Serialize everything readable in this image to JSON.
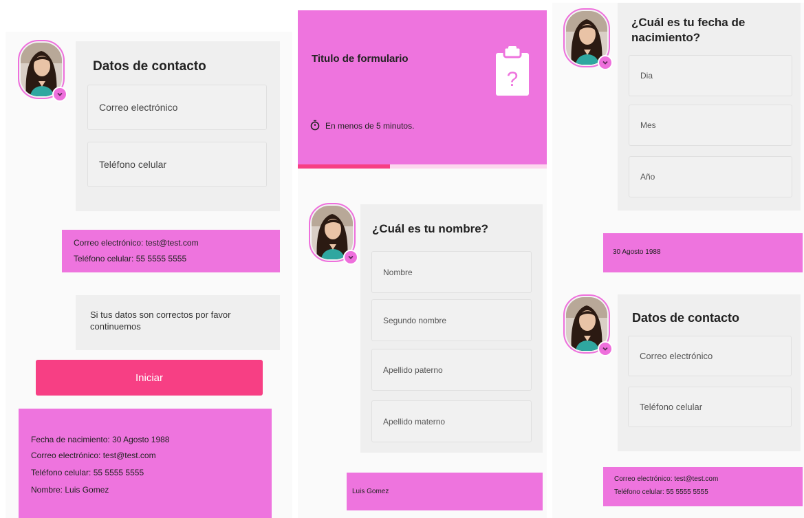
{
  "screen1": {
    "card_title": "Datos de contacto",
    "field_email": "Correo electrónico",
    "field_phone": "Teléfono celular",
    "answer_lines": [
      "Correo electrónico: test@test.com",
      "Teléfono celular: 55 5555 5555"
    ],
    "confirm_text": "Si tus datos son correctos por favor continuemos",
    "start_button": "Iniciar",
    "summary_lines": [
      "Fecha de nacimiento: 30 Agosto 1988",
      "Correo electrónico: test@test.com",
      "Teléfono celular: 55 5555 5555",
      "Nombre: Luis Gomez"
    ]
  },
  "screen2": {
    "form_title": "Titulo de formulario",
    "duration": "En menos de 5 minutos.",
    "progress": 0.37,
    "question": "¿Cuál es tu nombre?",
    "fields": [
      "Nombre",
      "Segundo nombre",
      "Apellido paterno",
      "Apellido materno"
    ],
    "answer": "Luis Gomez"
  },
  "screen3": {
    "question": "¿Cuál es tu fecha de nacimiento?",
    "fields": [
      "Dia",
      "Mes",
      "Año"
    ],
    "answer": "30 Agosto 1988",
    "card_title": "Datos de contacto",
    "field_email": "Correo electrónico",
    "field_phone": "Teléfono celular",
    "answer_lines": [
      "Correo electrónico: test@test.com",
      "Teléfono celular: 55 5555 5555"
    ]
  },
  "colors": {
    "accent_pink": "#ee74de",
    "button_pink": "#f73f84",
    "card_grey": "#efefef"
  },
  "icons": [
    "avatar-photo",
    "chevron-down-icon",
    "clipboard-question-icon",
    "stopwatch-icon"
  ]
}
